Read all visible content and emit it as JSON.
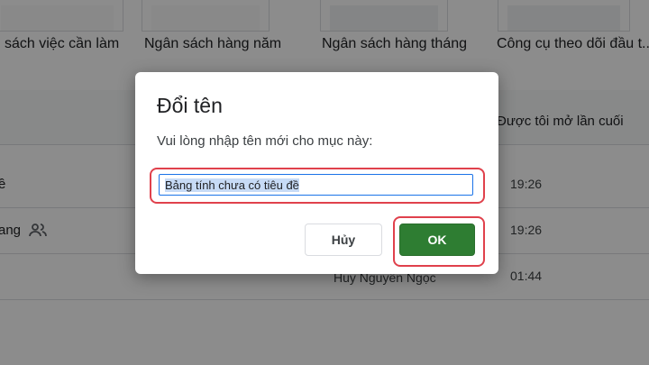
{
  "templates": [
    {
      "label": "sách việc cần làm"
    },
    {
      "label": "Ngân sách hàng năm"
    },
    {
      "label": "Ngân sách hàng tháng"
    },
    {
      "label": "Công cụ theo dõi đầu t..."
    }
  ],
  "file_list": {
    "last_opened_header": "Được tôi mở lần cuối",
    "rows": [
      {
        "name": "ề",
        "time": "19:26"
      },
      {
        "name": "ang",
        "time": "19:26",
        "shared": true
      },
      {
        "owner": "Huy Nguyễn Ngọc",
        "time": "01:44"
      }
    ]
  },
  "dialog": {
    "title": "Đổi tên",
    "prompt": "Vui lòng nhập tên mới cho mục này:",
    "input_value": "Bảng tính chưa có tiêu đề",
    "cancel_label": "Hủy",
    "ok_label": "OK"
  },
  "colors": {
    "ok_button": "#2e7d32",
    "highlight": "#e0414c",
    "selection": "#c7dbf6"
  }
}
